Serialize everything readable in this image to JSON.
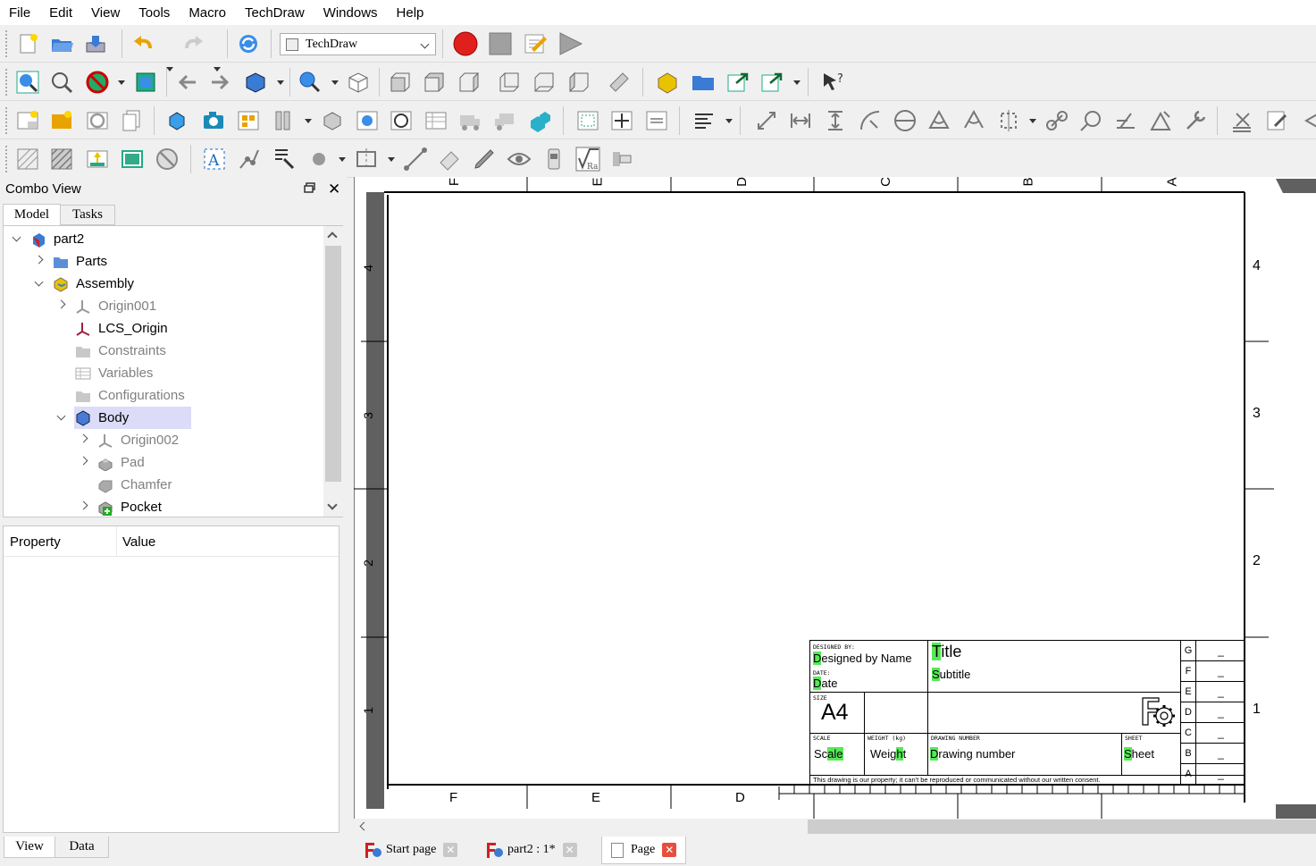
{
  "menu": [
    "File",
    "Edit",
    "View",
    "Tools",
    "Macro",
    "TechDraw",
    "Windows",
    "Help"
  ],
  "workbench": "TechDraw",
  "combo": {
    "title": "Combo View",
    "tabs": [
      "Model",
      "Tasks"
    ],
    "bottom_tabs": [
      "View",
      "Data"
    ],
    "prop_header": [
      "Property",
      "Value"
    ]
  },
  "tree": [
    {
      "label": "part2",
      "level": 0,
      "expand": "open",
      "icon": "document-icon",
      "dim": false
    },
    {
      "label": "Parts",
      "level": 1,
      "expand": "closed",
      "icon": "folder-icon",
      "dim": false
    },
    {
      "label": "Assembly",
      "level": 1,
      "expand": "open",
      "icon": "assembly-icon",
      "dim": false
    },
    {
      "label": "Origin001",
      "level": 2,
      "expand": "closed",
      "icon": "origin-icon",
      "dim": true
    },
    {
      "label": "LCS_Origin",
      "level": 2,
      "expand": "",
      "icon": "lcs-icon",
      "dim": false
    },
    {
      "label": "Constraints",
      "level": 2,
      "expand": "",
      "icon": "folder-grey-icon",
      "dim": true
    },
    {
      "label": "Variables",
      "level": 2,
      "expand": "",
      "icon": "spreadsheet-icon",
      "dim": true
    },
    {
      "label": "Configurations",
      "level": 2,
      "expand": "",
      "icon": "folder-grey-icon",
      "dim": true
    },
    {
      "label": "Body",
      "level": 2,
      "expand": "open",
      "icon": "body-icon",
      "dim": false,
      "selected": true
    },
    {
      "label": "Origin002",
      "level": 3,
      "expand": "closed",
      "icon": "origin-icon",
      "dim": true
    },
    {
      "label": "Pad",
      "level": 3,
      "expand": "closed",
      "icon": "pad-icon",
      "dim": true
    },
    {
      "label": "Chamfer",
      "level": 3,
      "expand": "",
      "icon": "chamfer-icon",
      "dim": true
    },
    {
      "label": "Pocket",
      "level": 3,
      "expand": "closed",
      "icon": "pocket-icon",
      "dim": false
    }
  ],
  "sheet": {
    "top_letters": [
      "F",
      "E",
      "D",
      "C",
      "B",
      "A"
    ],
    "bottom_letters": [
      "F",
      "E",
      "D"
    ],
    "right_numbers": [
      "4",
      "3",
      "2",
      "1"
    ],
    "left_numbers": [
      "4",
      "3",
      "2",
      "1"
    ],
    "title_block": {
      "designed_by_label": "DESIGNED BY:",
      "designed_by": "Designed by Name",
      "date_label": "DATE:",
      "date": "Date",
      "title": "Title",
      "subtitle": "Subtitle",
      "size_label": "SIZE",
      "size": "A4",
      "scale_label": "SCALE",
      "scale": "Scale",
      "weight_label": "WEIGHT (kg)",
      "weight": "Weight",
      "drawing_number_label": "DRAWING NUMBER",
      "drawing_number": "Drawing number",
      "sheet_label": "SHEET",
      "sheet": "Sheet",
      "footer": "This drawing is our property; it can't be reproduced or communicated without our written consent.",
      "revisions": [
        "G",
        "F",
        "E",
        "D",
        "C",
        "B",
        "A"
      ],
      "rev_value": "_"
    }
  },
  "doc_tabs": [
    {
      "label": "Start page",
      "active": false
    },
    {
      "label": "part2 : 1*",
      "active": false
    },
    {
      "label": "Page",
      "active": true
    }
  ],
  "colors": {
    "highlight": "#57e857",
    "selection": "#dcdcf8",
    "record": "#e0201c"
  }
}
